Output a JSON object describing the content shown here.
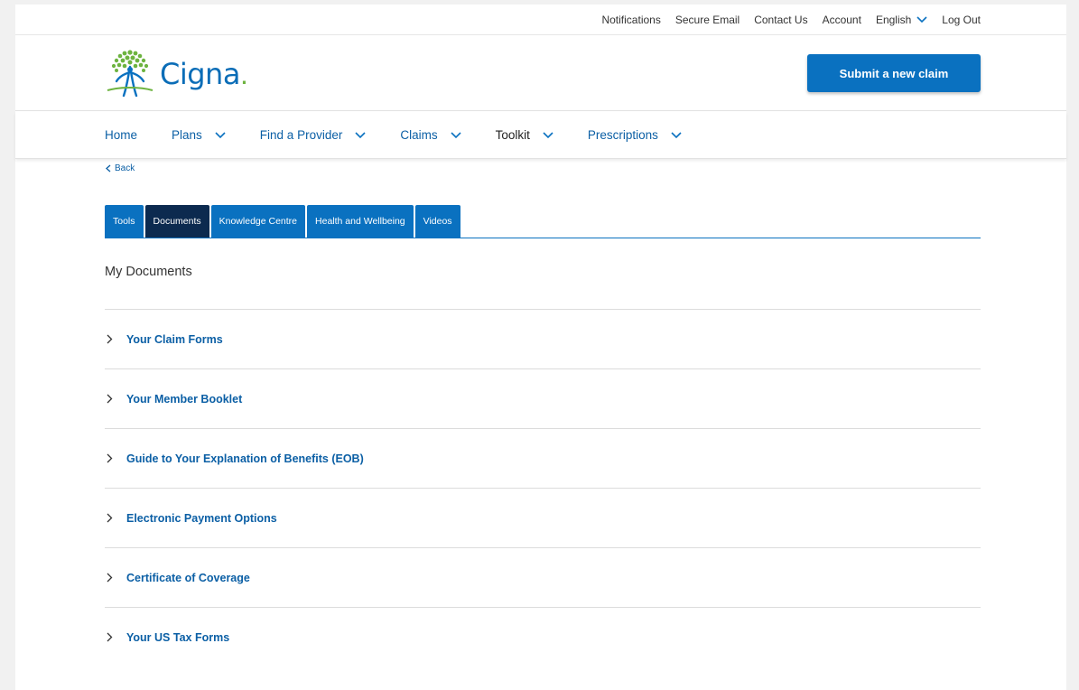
{
  "utility_nav": {
    "notifications": "Notifications",
    "secure_email": "Secure Email",
    "contact_us": "Contact Us",
    "account": "Account",
    "language": "English",
    "log_out": "Log Out"
  },
  "brand": {
    "name": "Cigna",
    "dot": ".",
    "submit_claim": "Submit a new claim",
    "colors": {
      "primary": "#0a71c0",
      "brand_green": "#6db33f",
      "dark_tab": "#0c2a4f"
    }
  },
  "main_nav": {
    "home": "Home",
    "plans": "Plans",
    "find_provider": "Find a Provider",
    "claims": "Claims",
    "toolkit": "Toolkit",
    "prescriptions": "Prescriptions"
  },
  "back": "Back",
  "tabs": [
    "Tools",
    "Documents",
    "Knowledge Centre",
    "Health and Wellbeing",
    "Videos"
  ],
  "section_title": "My Documents",
  "documents": [
    "Your Claim Forms",
    "Your Member Booklet",
    "Guide to Your Explanation of Benefits (EOB)",
    "Electronic Payment Options",
    "Certificate of Coverage",
    "Your US Tax Forms"
  ]
}
